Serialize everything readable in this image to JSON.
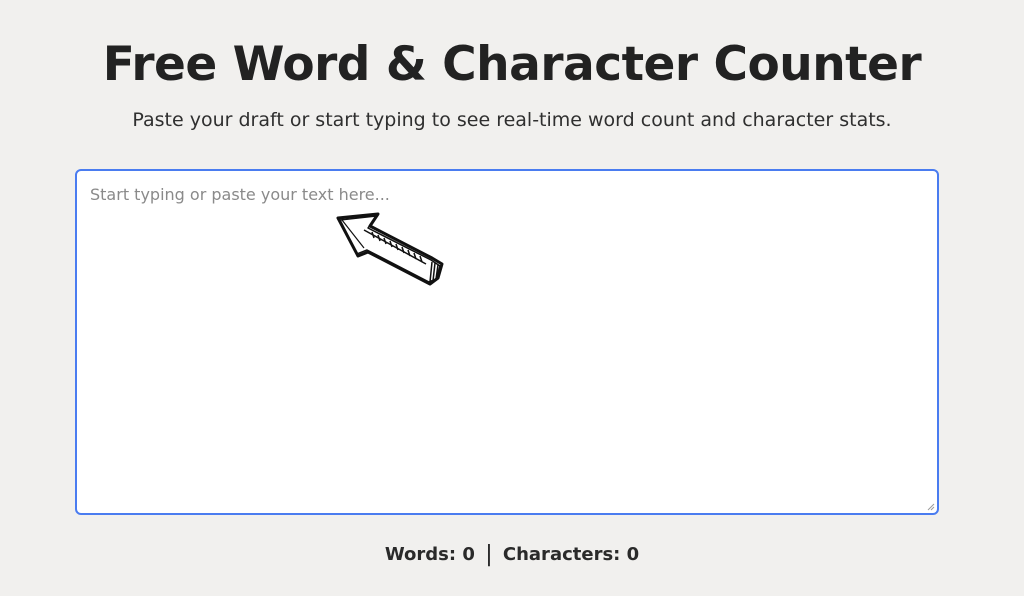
{
  "header": {
    "title": "Free Word & Character Counter",
    "subtitle": "Paste your draft or start typing to see real-time word count and character stats."
  },
  "editor": {
    "placeholder": "Start typing or paste your text here...",
    "value": ""
  },
  "stats": {
    "words_label": "Words: ",
    "words_value": "0",
    "separator": "|",
    "characters_label": "Characters: ",
    "characters_value": "0"
  },
  "illustration": {
    "icon": "hand-drawn-arrow-icon"
  },
  "colors": {
    "page_background": "#f1f0ee",
    "editor_border": "#4a7cf0",
    "text": "#222222"
  }
}
